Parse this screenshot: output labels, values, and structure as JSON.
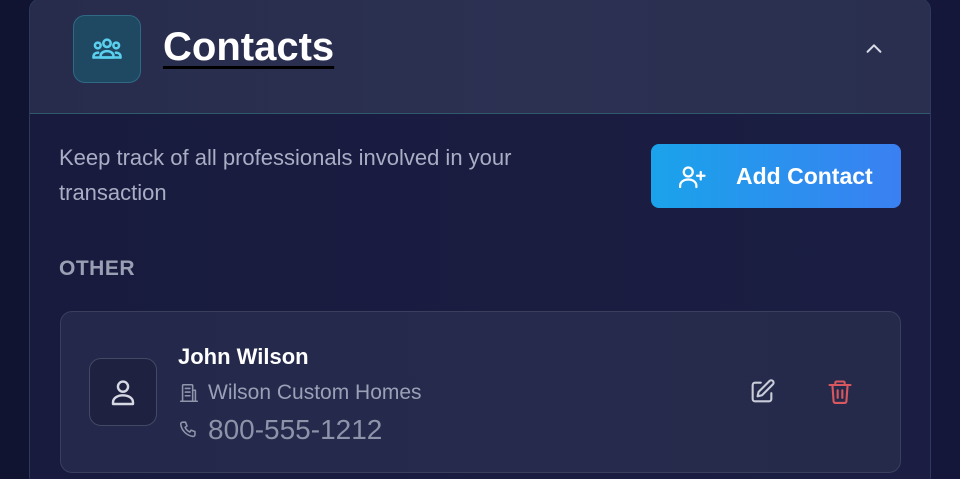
{
  "panel": {
    "title": "Contacts",
    "header_icon": "users-group-icon",
    "collapse_icon": "chevron-up-icon"
  },
  "body": {
    "description": "Keep track of all professionals involved in your transaction",
    "add_button": {
      "label": "Add Contact",
      "icon": "user-plus-icon"
    },
    "section_label": "OTHER"
  },
  "contacts": [
    {
      "name": "John Wilson",
      "company": "Wilson Custom Homes",
      "phone": "800-555-1212",
      "avatar_icon": "user-icon",
      "company_icon": "building-icon",
      "phone_icon": "phone-icon",
      "edit_icon": "edit-icon",
      "delete_icon": "trash-icon"
    }
  ],
  "colors": {
    "accent_cyan": "#5ad0ee",
    "button_gradient_start": "#1aa3ea",
    "button_gradient_end": "#3a80f2",
    "delete_red": "#d9575f",
    "panel_bg": "#1a1d40",
    "header_bg": "#2a2f50"
  }
}
